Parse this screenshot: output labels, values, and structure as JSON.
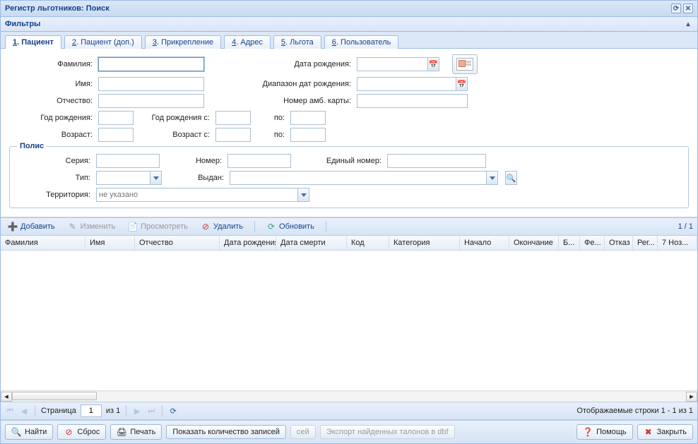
{
  "window": {
    "title": "Регистр льготников: Поиск"
  },
  "filters": {
    "title": "Фильтры"
  },
  "tabs": [
    {
      "num": "1",
      "label": "Пациент",
      "active": true
    },
    {
      "num": "2",
      "label": "Пациент (доп.)"
    },
    {
      "num": "3",
      "label": "Прикрепление"
    },
    {
      "num": "4",
      "label": "Адрес"
    },
    {
      "num": "5",
      "label": "Льгота"
    },
    {
      "num": "6",
      "label": "Пользователь"
    }
  ],
  "form": {
    "lastname": "Фамилия:",
    "firstname": "Имя:",
    "patronymic": "Отчество:",
    "birthyear": "Год рождения:",
    "age": "Возраст:",
    "birthdate": "Дата рождения:",
    "birthdate_range": "Диапазон дат рождения:",
    "amb_no": "Номер амб. карты:",
    "birthyear_from": "Год рождения с:",
    "to": "по:",
    "age_from": "Возраст с:"
  },
  "polis": {
    "legend": "Полис",
    "series": "Серия:",
    "number": "Номер:",
    "unified": "Единый номер:",
    "type": "Тип:",
    "issued": "Выдан:",
    "territory": "Территория:",
    "territory_placeholder": "не указано"
  },
  "toolbar": {
    "add": "Добавить",
    "edit": "Изменить",
    "view": "Просмотреть",
    "delete": "Удалить",
    "refresh": "Обновить",
    "counter": "1 / 1"
  },
  "grid": {
    "cols": [
      "Фамилия",
      "Имя",
      "Отчество",
      "Дата рождения",
      "Дата смерти",
      "Код",
      "Категория",
      "Начало",
      "Окончание",
      "Б...",
      "Фе...",
      "Отказ",
      "Рег...",
      "7 Ноз..."
    ]
  },
  "pager": {
    "page_label": "Страница",
    "page": "1",
    "of": "из 1",
    "status": "Отображаемые строки 1 - 1 из 1"
  },
  "buttons": {
    "find": "Найти",
    "reset": "Сброс",
    "print": "Печать",
    "show_count": "Показать количество записей",
    "sei": "сей",
    "export": "Экспорт найденных талонов в dbf",
    "help": "Помощь",
    "close": "Закрыть"
  }
}
